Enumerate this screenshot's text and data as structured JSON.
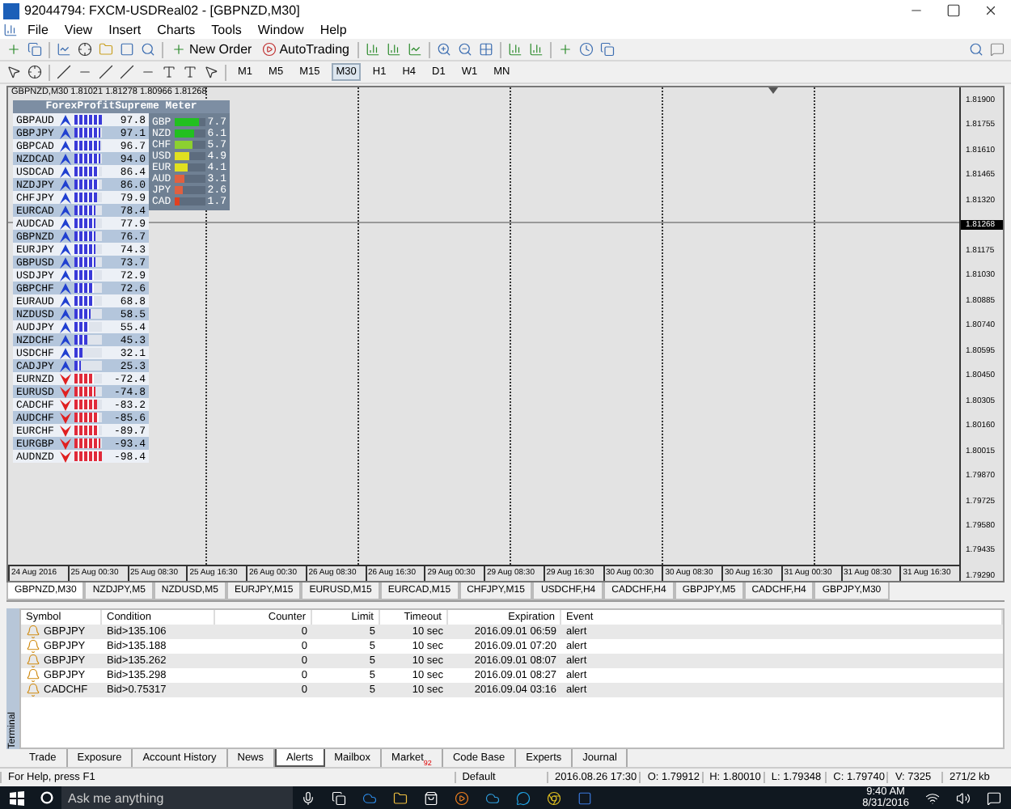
{
  "window": {
    "title": "92044794: FXCM-USDReal02 - [GBPNZD,M30]"
  },
  "menu": [
    "File",
    "View",
    "Insert",
    "Charts",
    "Tools",
    "Window",
    "Help"
  ],
  "toolbar": {
    "new_order": "New Order",
    "autotrading": "AutoTrading"
  },
  "timeframes": [
    {
      "label": "M1",
      "selected": false
    },
    {
      "label": "M5",
      "selected": false
    },
    {
      "label": "M15",
      "selected": false
    },
    {
      "label": "M30",
      "selected": true
    },
    {
      "label": "H1",
      "selected": false
    },
    {
      "label": "H4",
      "selected": false
    },
    {
      "label": "D1",
      "selected": false
    },
    {
      "label": "W1",
      "selected": false
    },
    {
      "label": "MN",
      "selected": false
    }
  ],
  "chart": {
    "header": "GBPNZD,M30  1.81021 1.81278 1.80966 1.81268",
    "meter": {
      "title": "ForexProfitSupreme Meter",
      "pairs": [
        {
          "symbol": "GBPAUD",
          "kind": "up",
          "level": 0.98,
          "value": "97.8"
        },
        {
          "symbol": "GBPJPY",
          "kind": "up",
          "level": 0.97,
          "value": "97.1"
        },
        {
          "symbol": "GBPCAD",
          "kind": "up",
          "level": 0.97,
          "value": "96.7"
        },
        {
          "symbol": "NZDCAD",
          "kind": "up",
          "level": 0.94,
          "value": "94.0"
        },
        {
          "symbol": "USDCAD",
          "kind": "up",
          "level": 0.86,
          "value": "86.4"
        },
        {
          "symbol": "NZDJPY",
          "kind": "up",
          "level": 0.86,
          "value": "86.0"
        },
        {
          "symbol": "CHFJPY",
          "kind": "up",
          "level": 0.8,
          "value": "79.9"
        },
        {
          "symbol": "EURCAD",
          "kind": "up",
          "level": 0.78,
          "value": "78.4"
        },
        {
          "symbol": "AUDCAD",
          "kind": "up",
          "level": 0.78,
          "value": "77.9"
        },
        {
          "symbol": "GBPNZD",
          "kind": "up",
          "level": 0.77,
          "value": "76.7"
        },
        {
          "symbol": "EURJPY",
          "kind": "up",
          "level": 0.74,
          "value": "74.3"
        },
        {
          "symbol": "GBPUSD",
          "kind": "up",
          "level": 0.74,
          "value": "73.7"
        },
        {
          "symbol": "USDJPY",
          "kind": "up",
          "level": 0.73,
          "value": "72.9"
        },
        {
          "symbol": "GBPCHF",
          "kind": "up",
          "level": 0.73,
          "value": "72.6"
        },
        {
          "symbol": "EURAUD",
          "kind": "up",
          "level": 0.69,
          "value": "68.8"
        },
        {
          "symbol": "NZDUSD",
          "kind": "up",
          "level": 0.59,
          "value": "58.5"
        },
        {
          "symbol": "AUDJPY",
          "kind": "up",
          "level": 0.55,
          "value": "55.4"
        },
        {
          "symbol": "NZDCHF",
          "kind": "up",
          "level": 0.45,
          "value": "45.3"
        },
        {
          "symbol": "USDCHF",
          "kind": "up",
          "level": 0.32,
          "value": "32.1"
        },
        {
          "symbol": "CADJPY",
          "kind": "up",
          "level": 0.25,
          "value": "25.3"
        },
        {
          "symbol": "EURNZD",
          "kind": "down",
          "level": 0.72,
          "value": "-72.4"
        },
        {
          "symbol": "EURUSD",
          "kind": "down",
          "level": 0.75,
          "value": "-74.8"
        },
        {
          "symbol": "CADCHF",
          "kind": "down",
          "level": 0.83,
          "value": "-83.2"
        },
        {
          "symbol": "AUDCHF",
          "kind": "down",
          "level": 0.86,
          "value": "-85.6"
        },
        {
          "symbol": "EURCHF",
          "kind": "down",
          "level": 0.9,
          "value": "-89.7"
        },
        {
          "symbol": "EURGBP",
          "kind": "down",
          "level": 0.93,
          "value": "-93.4"
        },
        {
          "symbol": "AUDNZD",
          "kind": "down",
          "level": 0.98,
          "value": "-98.4"
        }
      ],
      "currencies": [
        {
          "code": "GBP",
          "level": 0.77,
          "color": "#22c020",
          "value": "7.7"
        },
        {
          "code": "NZD",
          "level": 0.61,
          "color": "#22c020",
          "value": "6.1"
        },
        {
          "code": "CHF",
          "level": 0.57,
          "color": "#8cd030",
          "value": "5.7"
        },
        {
          "code": "USD",
          "level": 0.49,
          "color": "#e0e020",
          "value": "4.9"
        },
        {
          "code": "EUR",
          "level": 0.41,
          "color": "#e0e020",
          "value": "4.1"
        },
        {
          "code": "AUD",
          "level": 0.31,
          "color": "#e06040",
          "value": "3.1"
        },
        {
          "code": "JPY",
          "level": 0.26,
          "color": "#e06040",
          "value": "2.6"
        },
        {
          "code": "CAD",
          "level": 0.17,
          "color": "#e04020",
          "value": "1.7"
        }
      ]
    },
    "prices": [
      {
        "label": "1.81900",
        "kind": "tick"
      },
      {
        "label": "1.81755",
        "kind": "tick"
      },
      {
        "label": "1.81610",
        "kind": "tick"
      },
      {
        "label": "1.81465",
        "kind": "tick"
      },
      {
        "label": "1.81320",
        "kind": "tick"
      },
      {
        "label": "1.81268",
        "kind": "current"
      },
      {
        "label": "1.81175",
        "kind": "tick"
      },
      {
        "label": "1.81030",
        "kind": "tick"
      },
      {
        "label": "1.80885",
        "kind": "tick"
      },
      {
        "label": "1.80740",
        "kind": "tick"
      },
      {
        "label": "1.80595",
        "kind": "tick"
      },
      {
        "label": "1.80450",
        "kind": "tick"
      },
      {
        "label": "1.80305",
        "kind": "tick"
      },
      {
        "label": "1.80160",
        "kind": "tick"
      },
      {
        "label": "1.80015",
        "kind": "tick"
      },
      {
        "label": "1.79870",
        "kind": "tick"
      },
      {
        "label": "1.79725",
        "kind": "tick"
      },
      {
        "label": "1.79580",
        "kind": "tick"
      },
      {
        "label": "1.79435",
        "kind": "tick"
      },
      {
        "label": "1.79290",
        "kind": "tick"
      }
    ],
    "times": [
      "24 Aug 2016",
      "25 Aug 00:30",
      "25 Aug 08:30",
      "25 Aug 16:30",
      "26 Aug 00:30",
      "26 Aug 08:30",
      "26 Aug 16:30",
      "29 Aug 00:30",
      "29 Aug 08:30",
      "29 Aug 16:30",
      "30 Aug 00:30",
      "30 Aug 08:30",
      "30 Aug 16:30",
      "31 Aug 00:30",
      "31 Aug 08:30",
      "31 Aug 16:30"
    ]
  },
  "chart_tabs": [
    {
      "label": "GBPNZD,M30",
      "selected": true
    },
    {
      "label": "NZDJPY,M5",
      "selected": false
    },
    {
      "label": "NZDUSD,M5",
      "selected": false
    },
    {
      "label": "EURJPY,M15",
      "selected": false
    },
    {
      "label": "EURUSD,M15",
      "selected": false
    },
    {
      "label": "EURCAD,M15",
      "selected": false
    },
    {
      "label": "CHFJPY,M15",
      "selected": false
    },
    {
      "label": "USDCHF,H4",
      "selected": false
    },
    {
      "label": "CADCHF,H4",
      "selected": false
    },
    {
      "label": "GBPJPY,M5",
      "selected": false
    },
    {
      "label": "CADCHF,H4",
      "selected": false
    },
    {
      "label": "GBPJPY,M30",
      "selected": false
    }
  ],
  "terminal": {
    "label": "Terminal",
    "columns": [
      "Symbol",
      "Condition",
      "Counter",
      "Limit",
      "Timeout",
      "Expiration",
      "Event"
    ],
    "rows": [
      [
        "GBPJPY",
        "Bid>135.106",
        "0",
        "5",
        "10 sec",
        "2016.09.01 06:59",
        "alert"
      ],
      [
        "GBPJPY",
        "Bid>135.188",
        "0",
        "5",
        "10 sec",
        "2016.09.01 07:20",
        "alert"
      ],
      [
        "GBPJPY",
        "Bid>135.262",
        "0",
        "5",
        "10 sec",
        "2016.09.01 08:07",
        "alert"
      ],
      [
        "GBPJPY",
        "Bid>135.298",
        "0",
        "5",
        "10 sec",
        "2016.09.01 08:27",
        "alert"
      ],
      [
        "CADCHF",
        "Bid>0.75317",
        "0",
        "5",
        "10 sec",
        "2016.09.04 03:16",
        "alert"
      ]
    ],
    "tabs": [
      {
        "label": "Trade",
        "selected": false
      },
      {
        "label": "Exposure",
        "selected": false
      },
      {
        "label": "Account History",
        "selected": false
      },
      {
        "label": "News",
        "selected": false
      },
      {
        "label": "Alerts",
        "selected": true
      },
      {
        "label": "Mailbox",
        "selected": false
      },
      {
        "label": "Market",
        "selected": false,
        "badge": "92"
      },
      {
        "label": "Code Base",
        "selected": false
      },
      {
        "label": "Experts",
        "selected": false
      },
      {
        "label": "Journal",
        "selected": false
      }
    ]
  },
  "status_bar": [
    "For Help, press F1",
    "Default",
    "2016.08.26 17:30",
    "O: 1.79912",
    "H: 1.80010",
    "L: 1.79348",
    "C: 1.79740",
    "V: 7325",
    "271/2 kb"
  ],
  "taskbar": {
    "search": {
      "placeholder": "Ask me anything"
    },
    "time": "9:40 AM",
    "date": "8/31/2016"
  }
}
